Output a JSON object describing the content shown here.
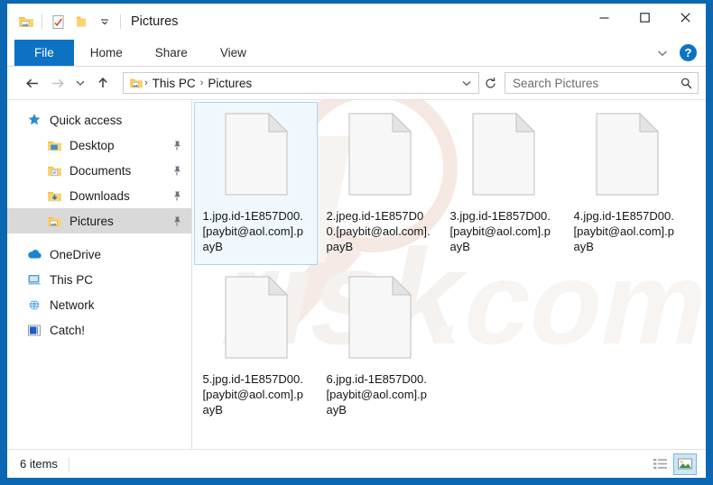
{
  "window": {
    "title": "Pictures",
    "quick_access_toolbar": [
      {
        "name": "pictures-folder-icon",
        "label": "Pictures"
      },
      {
        "name": "properties-icon",
        "label": "Properties"
      },
      {
        "name": "new-folder-icon",
        "label": "New folder"
      },
      {
        "name": "customize-chevron-icon",
        "label": "Customize Quick Access Toolbar"
      }
    ],
    "controls": {
      "minimize": "—",
      "maximize": "☐",
      "close": "✕"
    }
  },
  "ribbon": {
    "tabs": [
      {
        "label": "File",
        "active": true
      },
      {
        "label": "Home",
        "active": false
      },
      {
        "label": "Share",
        "active": false
      },
      {
        "label": "View",
        "active": false
      }
    ],
    "collapse_icon": "chevron-down-icon",
    "help_label": "?"
  },
  "navbar": {
    "back_icon": "back-arrow-icon",
    "forward_icon": "forward-arrow-icon",
    "recent_icon": "recent-locations-chevron-icon",
    "up_icon": "up-arrow-icon",
    "breadcrumb": {
      "icon": "pictures-folder-icon",
      "items": [
        "This PC",
        "Pictures"
      ],
      "separator": "›",
      "dropdown_icon": "chevron-down-icon"
    },
    "refresh_icon": "refresh-icon",
    "search": {
      "placeholder": "Search Pictures",
      "value": "",
      "icon": "search-icon"
    }
  },
  "sidebar": {
    "items": [
      {
        "label": "Quick access",
        "icon": "star-icon",
        "level": "root",
        "pinned": false,
        "selected": false
      },
      {
        "label": "Desktop",
        "icon": "desktop-folder-icon",
        "level": "lvl1",
        "pinned": true,
        "selected": false
      },
      {
        "label": "Documents",
        "icon": "documents-folder-icon",
        "level": "lvl1",
        "pinned": true,
        "selected": false
      },
      {
        "label": "Downloads",
        "icon": "downloads-folder-icon",
        "level": "lvl1",
        "pinned": true,
        "selected": false
      },
      {
        "label": "Pictures",
        "icon": "pictures-folder-icon",
        "level": "lvl1",
        "pinned": true,
        "selected": true
      },
      {
        "label": "OneDrive",
        "icon": "onedrive-cloud-icon",
        "level": "root",
        "pinned": false,
        "selected": false
      },
      {
        "label": "This PC",
        "icon": "this-pc-icon",
        "level": "root",
        "pinned": false,
        "selected": false
      },
      {
        "label": "Network",
        "icon": "network-icon",
        "level": "root",
        "pinned": false,
        "selected": false
      },
      {
        "label": "Catch!",
        "icon": "catch-app-icon",
        "level": "root",
        "pinned": false,
        "selected": false
      }
    ]
  },
  "content": {
    "files": [
      {
        "name": "1.jpg.id-1E857D00.[paybit@aol.com].payB",
        "icon": "generic-file-icon",
        "selected": true
      },
      {
        "name": "2.jpeg.id-1E857D00.[paybit@aol.com].payB",
        "icon": "generic-file-icon",
        "selected": false
      },
      {
        "name": "3.jpg.id-1E857D00.[paybit@aol.com].payB",
        "icon": "generic-file-icon",
        "selected": false
      },
      {
        "name": "4.jpg.id-1E857D00.[paybit@aol.com].payB",
        "icon": "generic-file-icon",
        "selected": false
      },
      {
        "name": "5.jpg.id-1E857D00.[paybit@aol.com].payB",
        "icon": "generic-file-icon",
        "selected": false
      },
      {
        "name": "6.jpg.id-1E857D00.[paybit@aol.com].payB",
        "icon": "generic-file-icon",
        "selected": false
      }
    ],
    "watermark_text": "pcrisk.com"
  },
  "statusbar": {
    "item_count_text": "6 items",
    "views": [
      {
        "name": "details-view-button",
        "label": "Details view",
        "active": false
      },
      {
        "name": "large-icons-view-button",
        "label": "Large icons view",
        "active": true
      }
    ]
  },
  "colors": {
    "frame_blue": "#0b67b2",
    "tab_blue": "#0d72c3",
    "selection_fill": "#f0f8fe",
    "selection_border": "#a8d6f0",
    "sidebar_selected": "#d9d9d9"
  }
}
